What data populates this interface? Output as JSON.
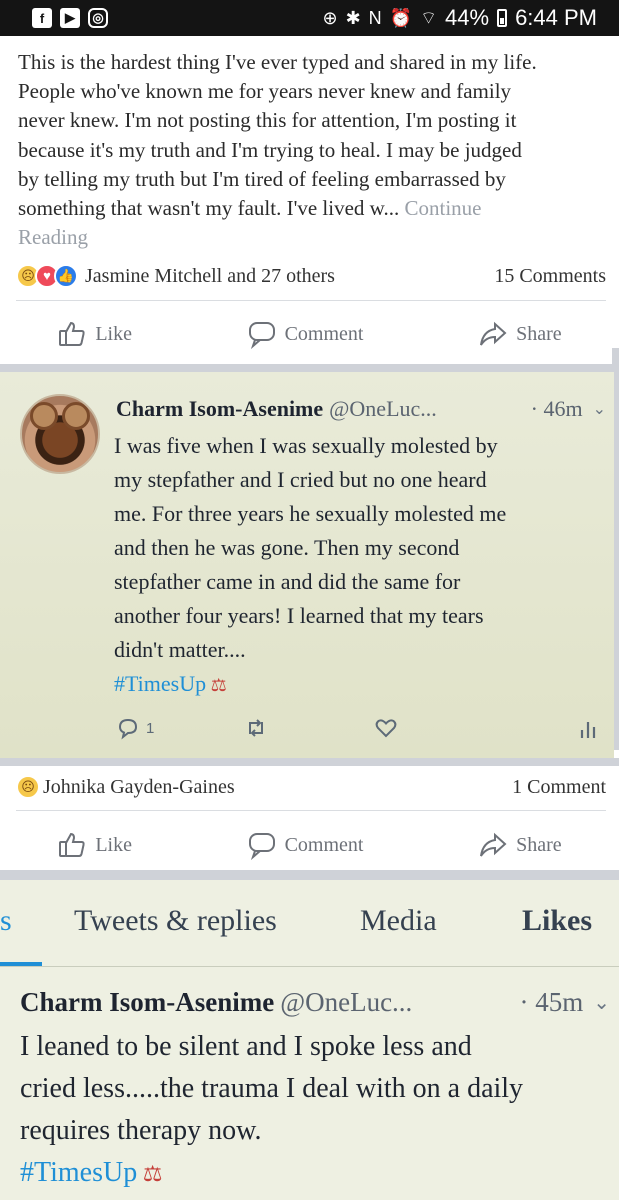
{
  "status_bar": {
    "left_icons": [
      "f",
      "▶",
      "◎"
    ],
    "right_icons": [
      "⊕",
      "✱",
      "N",
      "⏰",
      "⌔"
    ],
    "battery": "44%",
    "time": "6:44 PM"
  },
  "post": {
    "lines": [
      "This is the hardest thing I've ever typed and shared in my life.",
      "People who've known me for years never knew and family",
      "never knew.  I'm not posting this for attention, I'm posting it",
      "because it's my truth and I'm trying to heal. I may be judged",
      "by telling my truth but I'm tired of feeling embarrassed by",
      "something that wasn't my fault. I've lived w... "
    ],
    "continue_1": "Continue",
    "continue_2": "Reading",
    "reaction_names": "Jasmine Mitchell and 27 others",
    "comments": "15 Comments"
  },
  "actions": {
    "like": "Like",
    "comment": "Comment",
    "share": "Share"
  },
  "tweet1": {
    "name": "Charm Isom-Asenime",
    "handle": "@OneLuc...",
    "time": "· 46m",
    "lines": [
      "I was five when I was sexually molested by",
      "my stepfather and I cried but no one heard",
      "me. For three years he sexually molested me",
      "and then he was gone. Then my second",
      "stepfather came in and did the same for",
      "another four years! I learned that my tears",
      "didn't matter...."
    ],
    "hashtag": "#TimesUp",
    "reply_count": "1"
  },
  "shared": {
    "reaction_names": "Johnika Gayden-Gaines",
    "comments": "1 Comment"
  },
  "tabs": {
    "cut": "s",
    "tweets_replies": "Tweets & replies",
    "media": "Media",
    "likes": "Likes"
  },
  "tweet2": {
    "name": "Charm Isom-Asenime",
    "handle": "@OneLuc...",
    "time": "· 45m",
    "lines": [
      "I leaned to be silent and I spoke less and",
      "cried less.....the trauma I deal with on a daily",
      "requires therapy now."
    ],
    "hashtag": "#TimesUp"
  },
  "colors": {
    "hashtag": "#1f8fd6",
    "like_reaction": "#2b7ce9",
    "love_reaction": "#ef4a5a"
  }
}
